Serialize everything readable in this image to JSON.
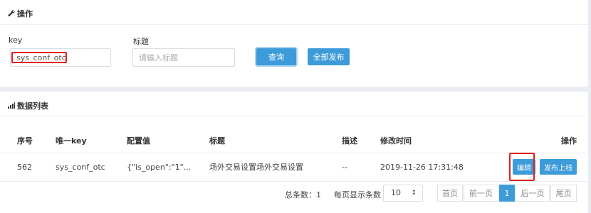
{
  "operations": {
    "title": "操作",
    "icon": "wrench-icon",
    "key_label": "key",
    "key_value": "sys_conf_otc",
    "title_label": "标题",
    "title_placeholder": "请输入标题",
    "query_button": "查询",
    "publish_all_button": "全部发布"
  },
  "data_list": {
    "title": "数据列表",
    "icon": "bar-chart-icon",
    "columns": [
      "序号",
      "唯一key",
      "配置值",
      "标题",
      "描述",
      "修改时间",
      "操作"
    ],
    "rows": [
      {
        "seq": "562",
        "key": "sys_conf_otc",
        "value": "{\"is_open\":\"1\"...",
        "title": "场外交易设置场外交易设置",
        "desc": "--",
        "modified": "2019-11-26 17:31:48",
        "edit_label": "编辑",
        "publish_label": "发布上线"
      }
    ]
  },
  "pagination": {
    "total_label": "总条数：1",
    "per_page_label": "每页显示条数",
    "per_page_value": "10",
    "first": "首页",
    "prev": "前一页",
    "current": "1",
    "next": "后一页",
    "last": "尾页"
  },
  "colors": {
    "accent": "#3d9bd9",
    "highlight": "#e02020",
    "background": "#e9edf2"
  }
}
